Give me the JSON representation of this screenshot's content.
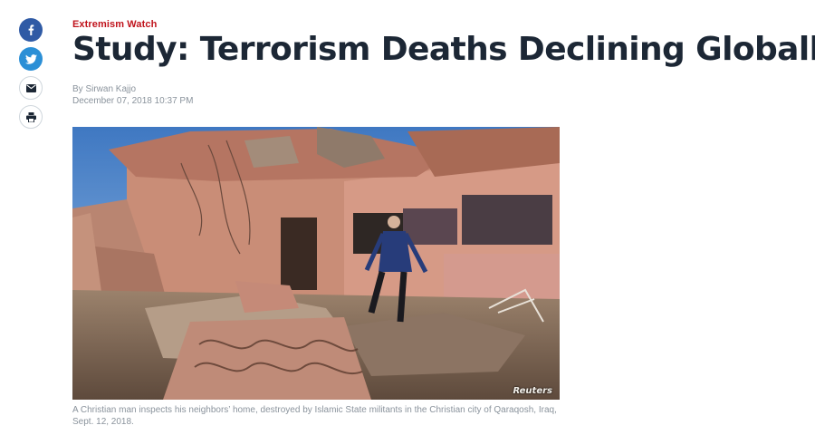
{
  "share": {
    "buttons": [
      {
        "network": "facebook",
        "icon": "facebook-icon",
        "color": "#2f5aa5"
      },
      {
        "network": "twitter",
        "icon": "twitter-icon",
        "color": "#2b8fd6"
      },
      {
        "network": "email",
        "icon": "envelope-icon",
        "color": "#1c2735"
      },
      {
        "network": "print",
        "icon": "printer-icon",
        "color": "#1c2735"
      }
    ]
  },
  "article": {
    "kicker": "Extremism Watch",
    "headline": "Study: Terrorism Deaths Declining Globally",
    "byline": "By Sirwan Kajjo",
    "date": "December 07, 2018 10:37 PM"
  },
  "photo": {
    "alt": "A Christian man inspects his neighbors' home, destroyed by Islamic State militants in the Christian city of Qaraqosh, Iraq, Sept. 12, 2018.",
    "credit": "Reuters",
    "caption": "A Christian man inspects his neighbors’ home, destroyed by Islamic State militants in the Christian city of Qaraqosh, Iraq, Sept. 12, 2018."
  },
  "colors": {
    "kicker": "#c0131c",
    "headline": "#1c2735",
    "meta": "#8a939c"
  }
}
